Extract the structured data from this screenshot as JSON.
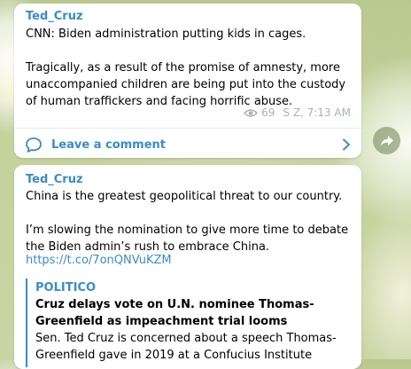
{
  "post1": {
    "author": "Ted_Cruz",
    "text": "CNN:  Biden administration putting kids in cages.\n\nTragically, as a result of the promise of amnesty, more unaccompanied children are being put into the custody of human traffickers and facing horrific abuse.",
    "views": "69",
    "signature_time": "S Z, 7:13 AM",
    "comment_label": "Leave a comment"
  },
  "post2": {
    "author": "Ted_Cruz",
    "text": "China is the greatest geopolitical threat to our country.\n\nI’m slowing the nomination to give more time to debate the Biden admin’s rush to embrace China.",
    "link": "https://t.co/7onQNVuKZM",
    "preview": {
      "site": "POLITICO",
      "title": "Cruz delays vote on U.N. nominee Thomas-Greenfield as impeachment trial looms",
      "description": "Sen. Ted Cruz is concerned about a speech Thomas-Greenfield gave in 2019 at a Confucius Institute funded by China."
    }
  },
  "icons": {
    "views": "eye-icon",
    "comment": "speech-bubble-icon",
    "chevron": "chevron-right-icon",
    "share": "forward-arrow-icon"
  },
  "colors": {
    "accent": "#3a8bc7",
    "meta": "#a7b1b7"
  }
}
